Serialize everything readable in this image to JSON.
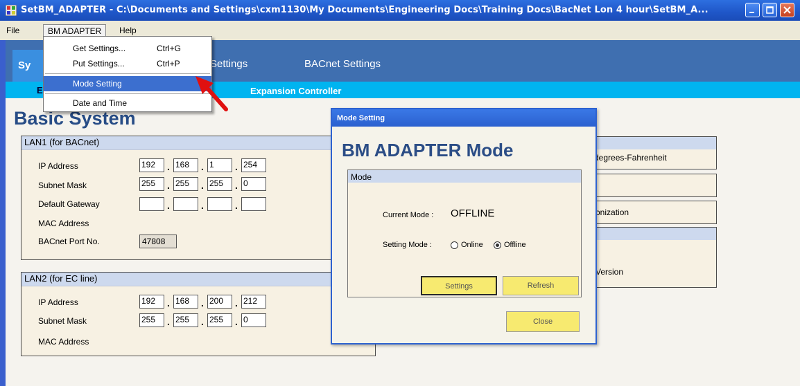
{
  "window": {
    "title": "SetBM_ADAPTER - C:\\Documents and Settings\\cxm1130\\My Documents\\Engineering Docs\\Training Docs\\BacNet Lon 4 hour\\SetBM_A..."
  },
  "menubar": {
    "file": "File",
    "bm_adapter": "BM ADAPTER",
    "help": "Help"
  },
  "dropdown": {
    "items": [
      {
        "label": "Get Settings...",
        "shortcut": "Ctrl+G"
      },
      {
        "label": "Put Settings...",
        "shortcut": "Ctrl+P"
      },
      {
        "label": "Mode Setting",
        "shortcut": ""
      },
      {
        "label": "Date and Time",
        "shortcut": ""
      }
    ]
  },
  "tabs": {
    "system": "Sy",
    "settings": "Settings",
    "bacnet": "BACnet Settings"
  },
  "subtabs": {
    "basic": "E",
    "expansion": "Expansion Controller"
  },
  "page_title": "Basic System",
  "lan1": {
    "title": "LAN1 (for BACnet)",
    "labels": {
      "ip": "IP Address",
      "subnet": "Subnet Mask",
      "gateway": "Default Gateway",
      "mac": "MAC Address",
      "port": "BACnet Port No."
    },
    "ip": [
      "192",
      "168",
      "1",
      "254"
    ],
    "subnet": [
      "255",
      "255",
      "255",
      "0"
    ],
    "gateway": [
      "",
      "",
      "",
      ""
    ],
    "port": "47808"
  },
  "lan2": {
    "title": "LAN2 (for EC line)",
    "labels": {
      "ip": "IP Address",
      "subnet": "Subnet Mask",
      "mac": "MAC Address"
    },
    "ip": [
      "192",
      "168",
      "200",
      "212"
    ],
    "subnet": [
      "255",
      "255",
      "255",
      "0"
    ]
  },
  "right_panel": {
    "temp_unit": "degrees-Fahrenheit",
    "sync": "onization",
    "version": "Version"
  },
  "dialog": {
    "title": "Mode Setting",
    "heading": "BM ADAPTER Mode",
    "group_title": "Mode",
    "current_mode_label": "Current Mode :",
    "current_mode_value": "OFFLINE",
    "setting_mode_label": "Setting Mode :",
    "option_online": "Online",
    "option_offline": "Offline",
    "selected": "Offline",
    "settings_button": "Settings",
    "refresh_button": "Refresh",
    "close_button": "Close"
  },
  "colors": {
    "titlebar": "#1f56c8",
    "tab_bar": "#3f6fb0",
    "subtab_bar": "#00b4f0",
    "highlight": "#3c6fcf",
    "button_yellow": "#f7ea70",
    "arrow": "#e01010"
  },
  "icons": {
    "app": "app-icon",
    "minimize": "minimize-icon",
    "maximize": "maximize-icon",
    "close": "close-icon",
    "pointer": "red-arrow-icon"
  }
}
